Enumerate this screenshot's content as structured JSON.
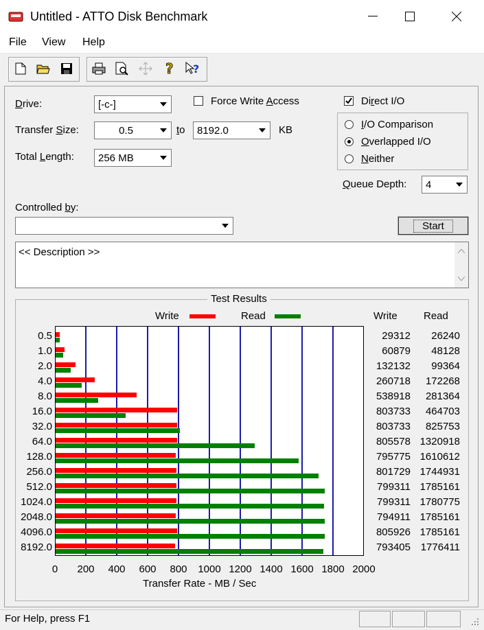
{
  "window": {
    "title": "Untitled - ATTO Disk Benchmark",
    "minimize": "–",
    "maximize": "☐",
    "close": "✕"
  },
  "menu": [
    "File",
    "View",
    "Help"
  ],
  "toolbar": {
    "icons": [
      "new-doc-icon",
      "open-folder-icon",
      "save-icon",
      "print-icon",
      "print-preview-icon",
      "move-icon",
      "help-icon",
      "context-help-icon"
    ]
  },
  "form": {
    "drive_label": "Drive:",
    "drive_value": "[-c-]",
    "force_write_label": "Force Write Access",
    "direct_io_label": "Direct I/O",
    "direct_io_checked": true,
    "transfer_size_label": "Transfer Size:",
    "transfer_from": "0.5",
    "to_label": "to",
    "transfer_to": "8192.0",
    "kb_label": "KB",
    "total_length_label": "Total Length:",
    "total_length_value": "256 MB",
    "io_options": [
      {
        "label": "I/O Comparison",
        "selected": false
      },
      {
        "label": "Overlapped I/O",
        "selected": true
      },
      {
        "label": "Neither",
        "selected": false
      }
    ],
    "queue_depth_label": "Queue Depth:",
    "queue_depth_value": "4",
    "controlled_by_label": "Controlled by:",
    "controlled_by_value": "",
    "start_label": "Start",
    "description": "<< Description >>"
  },
  "chart_data": {
    "type": "bar",
    "title": "Test Results",
    "orientation": "horizontal",
    "xlabel": "Transfer Rate - MB / Sec",
    "xlim": [
      0,
      2000
    ],
    "xticks": [
      "0",
      "200",
      "400",
      "600",
      "800",
      "1000",
      "1200",
      "1400",
      "1600",
      "1800",
      "2000"
    ],
    "categories": [
      "0.5",
      "1.0",
      "2.0",
      "4.0",
      "8.0",
      "16.0",
      "32.0",
      "64.0",
      "128.0",
      "256.0",
      "512.0",
      "1024.0",
      "2048.0",
      "4096.0",
      "8192.0"
    ],
    "series": [
      {
        "name": "Write",
        "color": "#ff0000",
        "values": [
          28.6,
          59.5,
          129.0,
          254.6,
          526.3,
          784.9,
          784.9,
          786.7,
          777.1,
          782.9,
          780.6,
          780.6,
          776.3,
          787.0,
          774.8
        ]
      },
      {
        "name": "Read",
        "color": "#008000",
        "values": [
          25.6,
          47.0,
          97.0,
          168.2,
          274.8,
          453.8,
          806.4,
          1289.9,
          1572.9,
          1704.0,
          1743.3,
          1739.0,
          1743.3,
          1743.3,
          1734.8
        ]
      }
    ],
    "table": {
      "headers": [
        "Write",
        "Read"
      ],
      "write": [
        "29312",
        "60879",
        "132132",
        "260718",
        "538918",
        "803733",
        "803733",
        "805578",
        "795775",
        "801729",
        "799311",
        "799311",
        "794911",
        "805926",
        "793405"
      ],
      "read": [
        "26240",
        "48128",
        "99364",
        "172268",
        "281364",
        "464703",
        "825753",
        "1320918",
        "1610612",
        "1744931",
        "1785161",
        "1780775",
        "1785161",
        "1785161",
        "1776411"
      ]
    },
    "grid": true,
    "legend": "top-center"
  },
  "status": {
    "text": "For Help, press F1"
  }
}
